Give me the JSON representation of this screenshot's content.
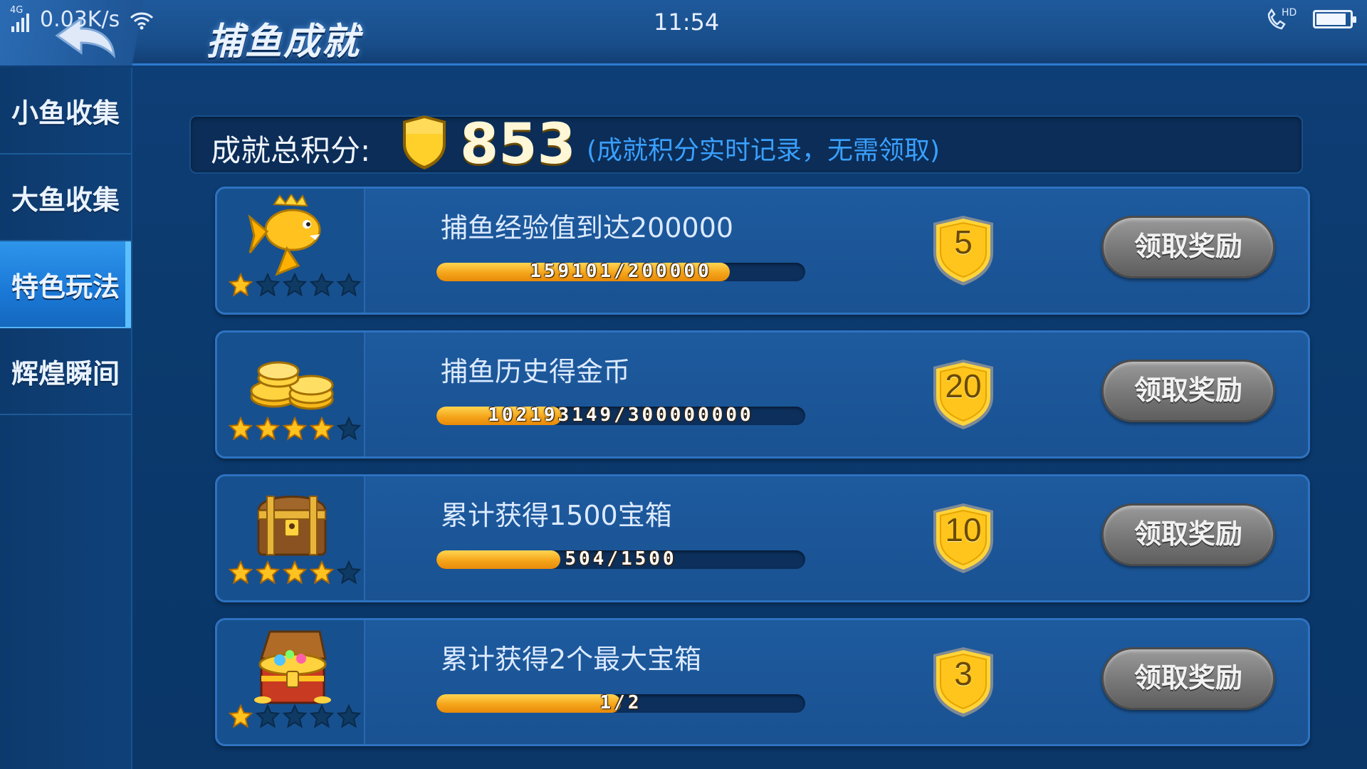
{
  "status": {
    "network": "4G",
    "speed": "0.03K/s",
    "time": "11:54",
    "call_badge": "HD",
    "battery_level": 0.9
  },
  "header": {
    "title": "捕鱼成就"
  },
  "sidebar": {
    "items": [
      {
        "label": "小鱼收集",
        "active": false
      },
      {
        "label": "大鱼收集",
        "active": false
      },
      {
        "label": "特色玩法",
        "active": true
      },
      {
        "label": "辉煌瞬间",
        "active": false
      }
    ]
  },
  "score": {
    "label": "成就总积分:",
    "value": "853",
    "note": "(成就积分实时记录，无需领取)"
  },
  "achievements": [
    {
      "title": "捕鱼经验值到达200000",
      "progress_text": "159101/200000",
      "progress_fraction": 0.7955,
      "reward": "5",
      "stars_filled": 1,
      "stars_total": 5,
      "icon": "crowned-fish-icon",
      "button": "领取奖励"
    },
    {
      "title": "捕鱼历史得金币",
      "progress_text": "102193149/300000000",
      "progress_fraction": 0.3406,
      "reward": "20",
      "stars_filled": 4,
      "stars_total": 5,
      "icon": "gold-coins-icon",
      "button": "领取奖励"
    },
    {
      "title": "累计获得1500宝箱",
      "progress_text": "504/1500",
      "progress_fraction": 0.336,
      "reward": "10",
      "stars_filled": 4,
      "stars_total": 5,
      "icon": "treasure-chest-icon",
      "button": "领取奖励"
    },
    {
      "title": "累计获得2个最大宝箱",
      "progress_text": "1/2",
      "progress_fraction": 0.5,
      "reward": "3",
      "stars_filled": 1,
      "stars_total": 5,
      "icon": "open-treasure-chest-icon",
      "button": "领取奖励"
    }
  ],
  "colors": {
    "background": "#0b3a6e",
    "accent_blue": "#2e95ea",
    "progress_gold": "#f5a51a",
    "note_blue": "#3aa0ff",
    "button_gray": "#7a7a7a",
    "star_filled": "#ffc21f",
    "star_empty": "#0f3a63"
  }
}
